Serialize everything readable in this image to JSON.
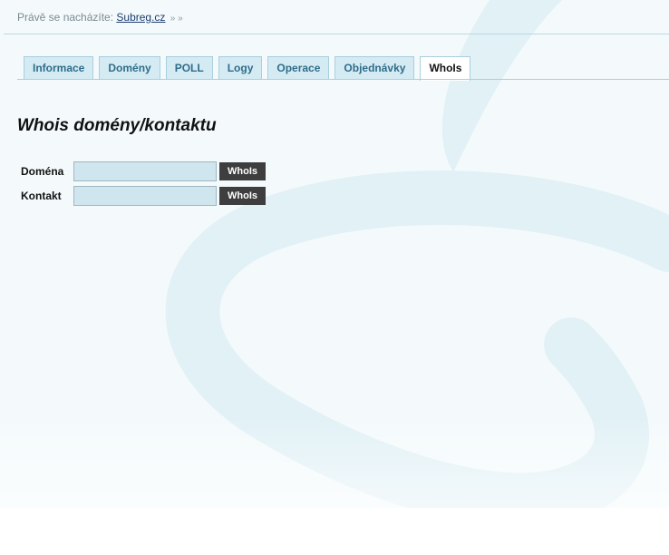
{
  "breadcrumb": {
    "prefix": "Právě se nacházíte:",
    "link": "Subreg.cz",
    "separator": "» »"
  },
  "tabs": [
    {
      "label": "Informace"
    },
    {
      "label": "Domény"
    },
    {
      "label": "POLL"
    },
    {
      "label": "Logy"
    },
    {
      "label": "Operace"
    },
    {
      "label": "Objednávky"
    },
    {
      "label": "WhoIs"
    }
  ],
  "active_tab": "WhoIs",
  "page": {
    "title": "Whois domény/kontaktu"
  },
  "form": {
    "domain": {
      "label": "Doména",
      "value": "",
      "button": "WhoIs"
    },
    "contact": {
      "label": "Kontakt",
      "value": "",
      "button": "WhoIs"
    }
  },
  "colors": {
    "tab_background": "#d5ebf3",
    "tab_text": "#2f6d8a",
    "button_background": "#3e3e3e",
    "input_background": "#cfe6ee"
  }
}
